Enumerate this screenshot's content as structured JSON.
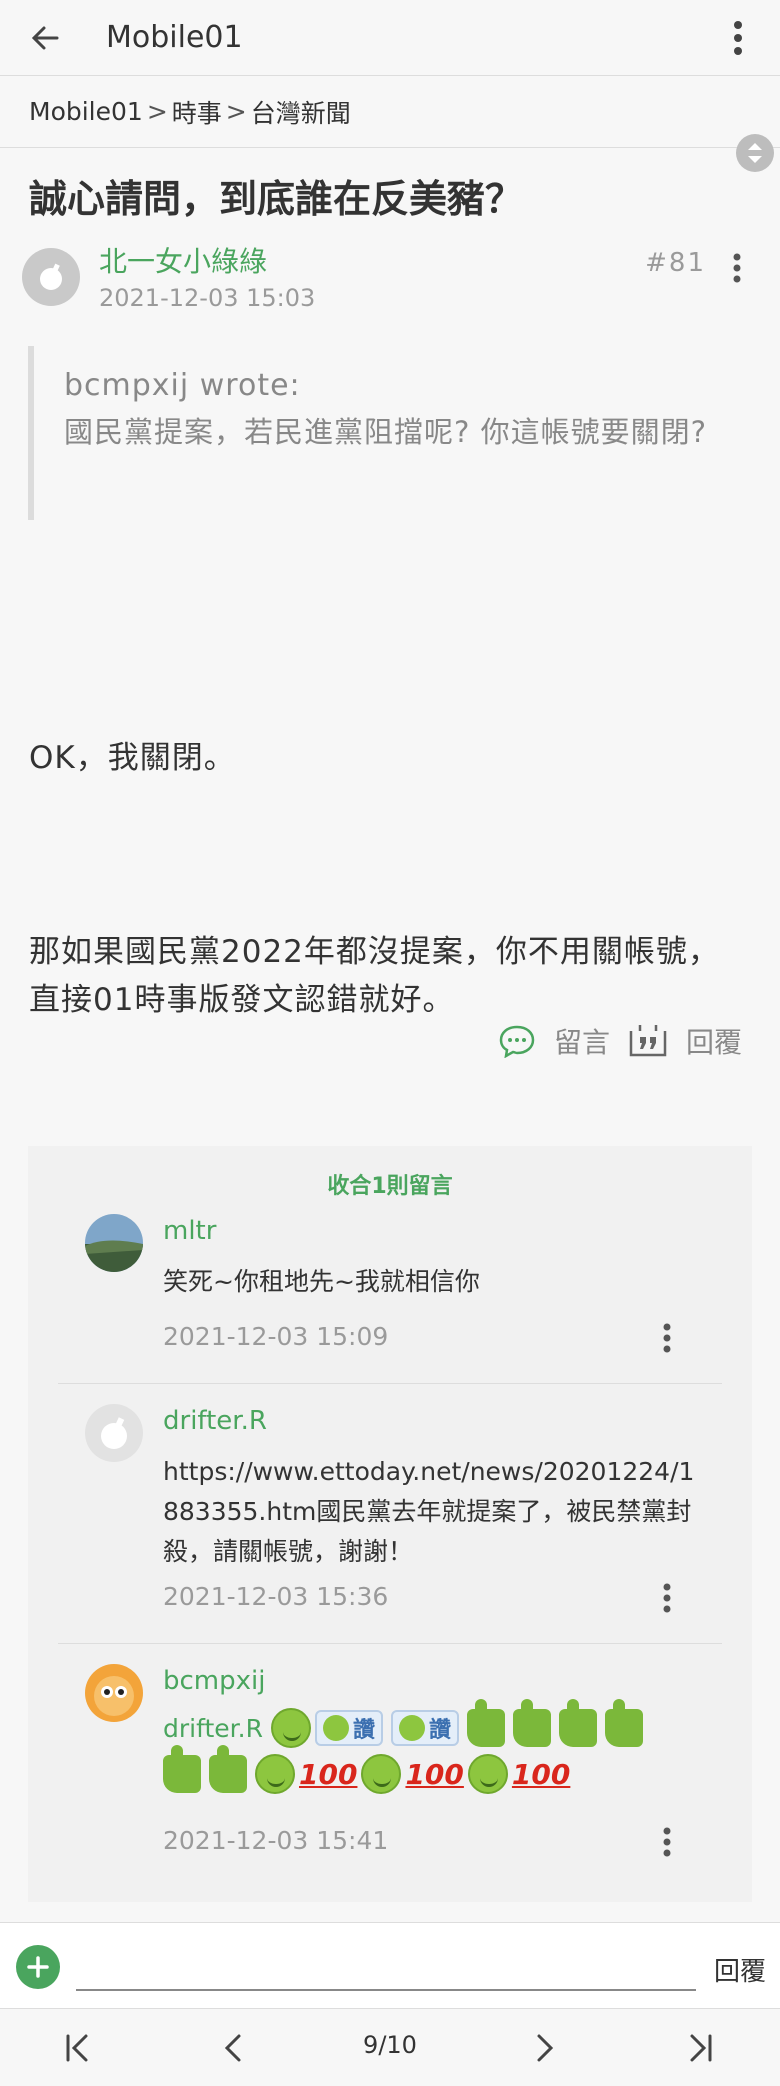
{
  "topbar": {
    "title": "Mobile01"
  },
  "breadcrumb": {
    "items": [
      "Mobile01",
      "時事",
      "台灣新聞"
    ],
    "separator": ">"
  },
  "post": {
    "title": "誠心請問，到底誰在反美豬？",
    "author": "北一女小綠綠",
    "date": "2021-12-03 15:03",
    "floor": "#81",
    "quote_author": "bcmpxij wrote:",
    "quote_text": "國民黨提案，若民進黨阻擋呢? 你這帳號要關閉?",
    "paragraph1": "OK，我關閉。",
    "paragraph2": "那如果國民黨2022年都沒提案，你不用關帳號，直接01時事版發文認錯就好。",
    "actions": {
      "comment": "留言",
      "reply": "回覆"
    }
  },
  "comments": {
    "collapse_label": "收合1則留言",
    "items": [
      {
        "name": "mltr",
        "text": "笑死~你租地先~我就相信你",
        "date": "2021-12-03 15:09"
      },
      {
        "name": "drifter.R",
        "text": "https://www.ettoday.net/news/20201224/1883355.htm國民黨去年就提案了，被民禁黨封殺，請關帳號，謝謝！",
        "date": "2021-12-03 15:36"
      },
      {
        "name": "bcmpxij",
        "mention": "drifter.R",
        "tag_text": "讚",
        "hundred": "100",
        "date": "2021-12-03 15:41"
      }
    ]
  },
  "reply_bar": {
    "placeholder": "",
    "send_label": "回覆"
  },
  "pager": {
    "label": "9/10"
  },
  "colors": {
    "brand_green": "#4aa55e",
    "muted": "#9a9a9a"
  }
}
